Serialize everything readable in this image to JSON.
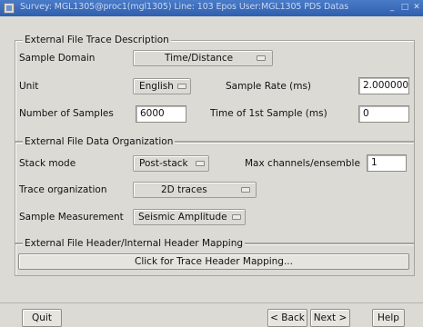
{
  "window": {
    "title": "Survey: MGL1305@proc1(mgl1305) Line: 103  Epos User:MGL1305  PDS Datas",
    "controls": [
      "_",
      "□",
      "✕"
    ]
  },
  "trace_description": {
    "legend": "External File Trace Description",
    "sample_domain_label": "Sample Domain",
    "sample_domain_value": "Time/Distance",
    "unit_label": "Unit",
    "unit_value": "English",
    "sample_rate_label": "Sample Rate (ms)",
    "sample_rate_value": "2.000000",
    "num_samples_label": "Number of Samples",
    "num_samples_value": "6000",
    "first_sample_label": "Time of 1st Sample (ms)",
    "first_sample_value": "0"
  },
  "data_organization": {
    "legend": "External File Data Organization",
    "stack_mode_label": "Stack mode",
    "stack_mode_value": "Post-stack",
    "max_channels_label": "Max channels/ensemble",
    "max_channels_value": "1",
    "trace_org_label": "Trace organization",
    "trace_org_value": "2D traces",
    "sample_measurement_label": "Sample Measurement",
    "sample_measurement_value": "Seismic Amplitude"
  },
  "header_mapping": {
    "legend": "External File Header/Internal Header Mapping",
    "button_label": "Click for Trace Header Mapping..."
  },
  "footer": {
    "quit_label": "Quit",
    "back_label": "< Back",
    "next_label": "Next >",
    "help_label": "Help"
  }
}
